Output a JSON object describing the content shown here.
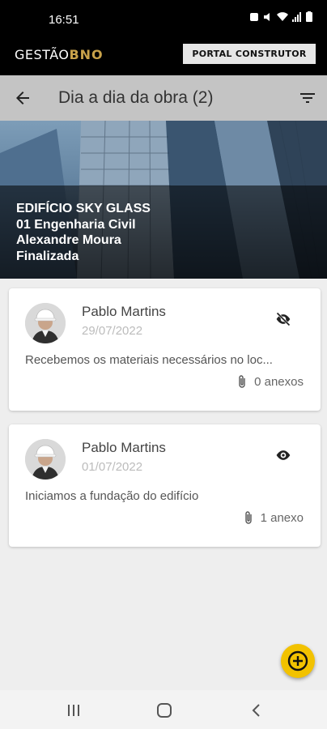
{
  "status": {
    "time": "16:51"
  },
  "header": {
    "logo_text_white": "GESTÃO",
    "logo_text_gold": "BNO",
    "portal_button": "PORTAL CONSTRUTOR"
  },
  "toolbar": {
    "title": "Dia a dia da obra (2)"
  },
  "hero": {
    "lines": [
      "EDIFÍCIO SKY GLASS",
      "01 Engenharia Civil",
      "Alexandre Moura",
      "Finalizada"
    ]
  },
  "entries": [
    {
      "name": "Pablo Martins",
      "date": "29/07/2022",
      "text": "Recebemos os materiais necessários no loc...",
      "attachments": "0 anexos",
      "visibility_icon": "eye-off-icon"
    },
    {
      "name": "Pablo Martins",
      "date": "01/07/2022",
      "text": "Iniciamos a fundação do edifício",
      "attachments": "1 anexo",
      "visibility_icon": "eye-icon"
    }
  ],
  "colors": {
    "accent": "#f2c200",
    "logo_gold": "#c8a24a",
    "toolbar": "#c4c4c4"
  }
}
